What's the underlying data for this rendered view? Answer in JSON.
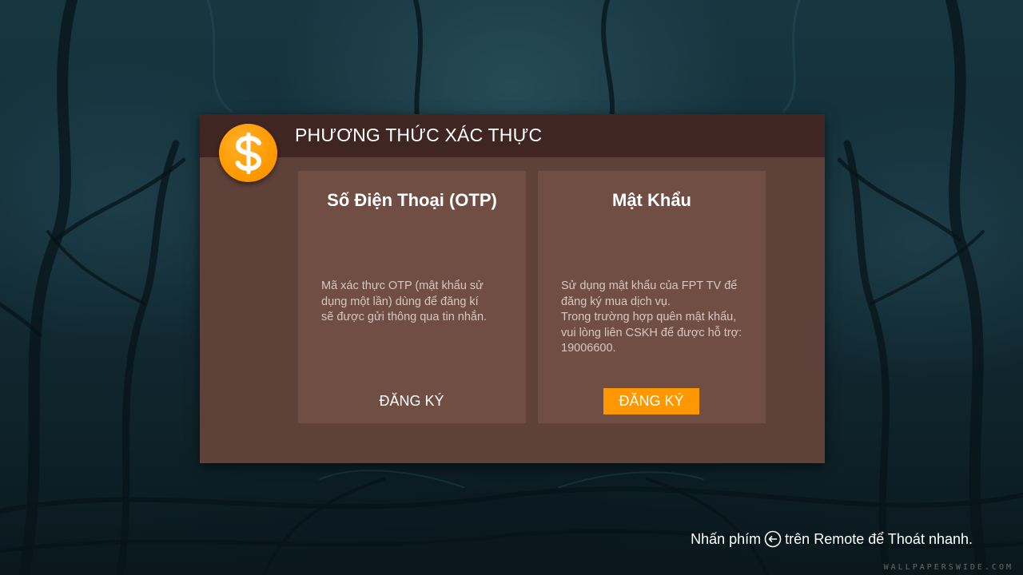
{
  "dialog": {
    "title": "PHƯƠNG THỨC XÁC THỰC",
    "icon": "dollar-coin-icon",
    "accent_color": "#ff9800"
  },
  "options": [
    {
      "title": "Số Điện Thoại (OTP)",
      "description": [
        "Mã xác thực OTP (mật khẩu sử",
        "dụng một lần) dùng để đăng kí",
        "sẽ được gửi thông qua tin nhắn."
      ],
      "button_label": "ĐĂNG KÝ",
      "selected": false
    },
    {
      "title": "Mật Khẩu",
      "description": [
        "Sử dụng mật khẩu của FPT TV để",
        "đăng ký mua dịch vụ.",
        "Trong trường hợp quên mật khẩu,",
        "vui lòng liên CSKH để được hỗ trợ:",
        "19006600."
      ],
      "button_label": "ĐĂNG KÝ",
      "selected": true
    }
  ],
  "footer": {
    "hint_prefix": "Nhấn phím",
    "hint_suffix": "trên Remote để Thoát nhanh.",
    "icon": "remote-back-icon"
  },
  "watermark": "WALLPAPERSWIDE.COM"
}
